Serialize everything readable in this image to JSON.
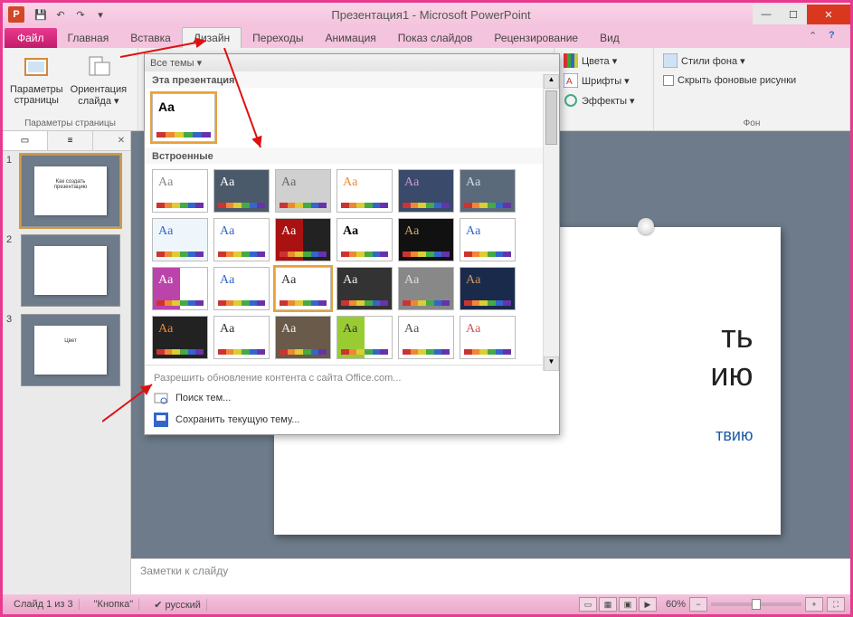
{
  "title": "Презентация1 - Microsoft PowerPoint",
  "qat": {
    "save": "💾",
    "undo": "↶",
    "redo": "↷"
  },
  "tabs": {
    "file": "Файл",
    "items": [
      "Главная",
      "Вставка",
      "Дизайн",
      "Переходы",
      "Анимация",
      "Показ слайдов",
      "Рецензирование",
      "Вид"
    ],
    "active": "Дизайн"
  },
  "ribbon": {
    "page_setup": {
      "page_params": "Параметры\nстраницы",
      "orientation": "Ориентация\nслайда ▾",
      "group": "Параметры страницы"
    },
    "colors": "Цвета ▾",
    "fonts": "Шрифты ▾",
    "effects": "Эффекты ▾",
    "bg_styles": "Стили фона ▾",
    "hide_bg": "Скрыть фоновые рисунки",
    "bg_group": "Фон"
  },
  "gallery": {
    "header": "Все темы ▾",
    "section1": "Эта презентация",
    "section2": "Встроенные",
    "office_update": "Разрешить обновление контента с сайта Office.com...",
    "browse": "Поиск тем...",
    "save_theme": "Сохранить текущую тему..."
  },
  "sidebar": {
    "tab_slides": "▭",
    "tab_outline": "≡",
    "slide1_title": "Как создать\nпрезентацию",
    "slide3_text": "Цвет"
  },
  "slide": {
    "title_frag1": "ть",
    "title_frag2": "ию",
    "sub_frag": "твию"
  },
  "notes": "Заметки к слайду",
  "status": {
    "slide_of": "Слайд 1 из 3",
    "theme": "\"Кнопка\"",
    "lang": "русский",
    "zoom": "60%"
  }
}
